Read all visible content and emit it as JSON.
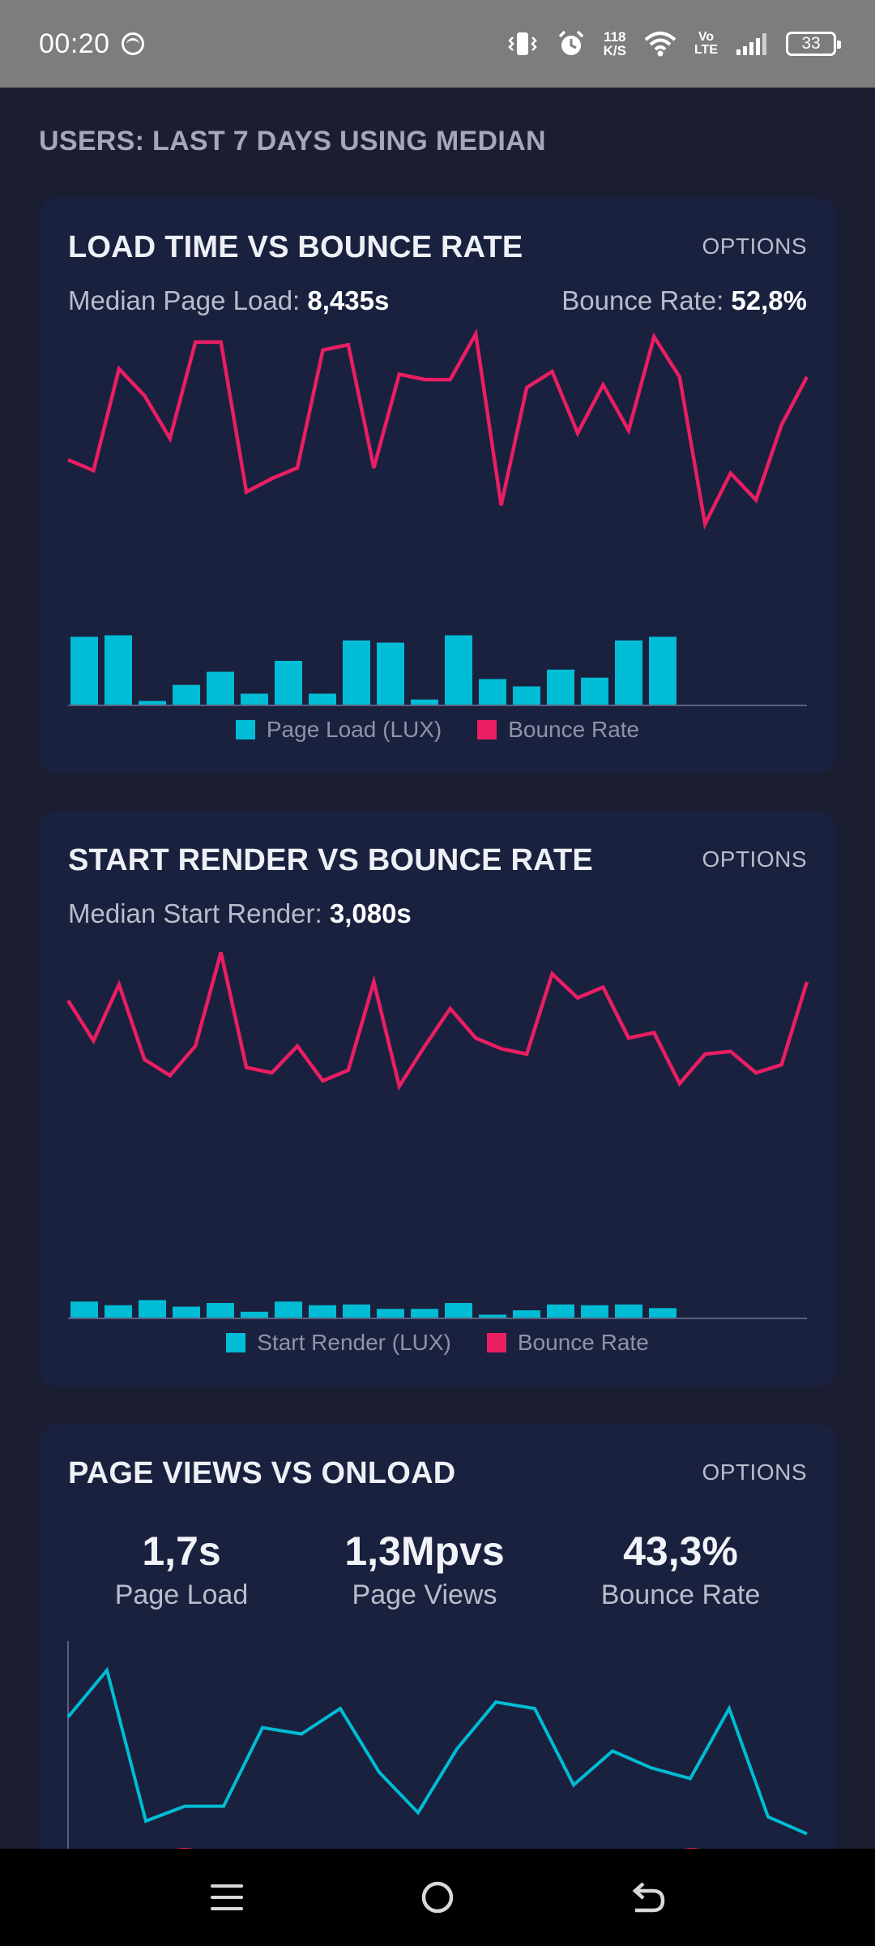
{
  "status": {
    "time": "00:20",
    "net_speed_value": "118",
    "net_speed_unit": "K/S",
    "volte_top": "Vo",
    "volte_bottom": "LTE",
    "battery": "33",
    "icons": [
      "face-icon",
      "vibrate-icon",
      "alarm-icon",
      "wifi-icon",
      "signal-icon",
      "battery-icon"
    ]
  },
  "page": {
    "heading": "USERS: LAST 7 DAYS USING MEDIAN"
  },
  "colors": {
    "bounce": "#e91e63",
    "bars": "#00bcd4",
    "card": "#19213e",
    "background": "#1b1d30"
  },
  "cards": [
    {
      "title": "LOAD TIME VS BOUNCE RATE",
      "options": "OPTIONS",
      "metric1_label": "Median Page Load: ",
      "metric1_value": "8,435s",
      "metric2_label": "Bounce Rate: ",
      "metric2_value": "52,8%",
      "legend": [
        "Page Load (LUX)",
        "Bounce Rate"
      ]
    },
    {
      "title": "START RENDER VS BOUNCE RATE",
      "options": "OPTIONS",
      "metric1_label": "Median Start Render: ",
      "metric1_value": "3,080s",
      "legend": [
        "Start Render (LUX)",
        "Bounce Rate"
      ]
    },
    {
      "title": "PAGE VIEWS VS ONLOAD",
      "options": "OPTIONS",
      "stats": [
        {
          "value": "1,7s",
          "label": "Page Load"
        },
        {
          "value": "1,3Mpvs",
          "label": "Page Views"
        },
        {
          "value": "43,3%",
          "label": "Bounce Rate"
        }
      ]
    }
  ],
  "chart_data": [
    {
      "type": "bar",
      "title": "LOAD TIME VS BOUNCE RATE",
      "series": [
        {
          "name": "Page Load (LUX)",
          "kind": "bar",
          "values": [
            0.93,
            0.95,
            0.05,
            0.27,
            0.45,
            0.15,
            0.6,
            0.15,
            0.88,
            0.85,
            0.07,
            0.95,
            0.35,
            0.25,
            0.48,
            0.37,
            0.88,
            0.93
          ]
        },
        {
          "name": "Bounce Rate",
          "kind": "line",
          "values": [
            0.53,
            0.49,
            0.87,
            0.77,
            0.61,
            0.97,
            0.97,
            0.41,
            0.46,
            0.5,
            0.94,
            0.96,
            0.5,
            0.85,
            0.83,
            0.83,
            1.0,
            0.36,
            0.8,
            0.86,
            0.63,
            0.81,
            0.64,
            0.99,
            0.84,
            0.29,
            0.48,
            0.38,
            0.66,
            0.84
          ]
        }
      ],
      "ylim": [
        0,
        1
      ]
    },
    {
      "type": "bar",
      "title": "START RENDER VS BOUNCE RATE",
      "series": [
        {
          "name": "Start Render (LUX)",
          "kind": "bar",
          "values": [
            0.22,
            0.17,
            0.24,
            0.15,
            0.2,
            0.08,
            0.22,
            0.17,
            0.18,
            0.12,
            0.12,
            0.2,
            0.04,
            0.1,
            0.18,
            0.17,
            0.18,
            0.13
          ]
        },
        {
          "name": "Bounce Rate",
          "kind": "line",
          "values": [
            0.8,
            0.65,
            0.86,
            0.58,
            0.52,
            0.63,
            0.98,
            0.55,
            0.53,
            0.63,
            0.5,
            0.54,
            0.87,
            0.48,
            0.63,
            0.77,
            0.66,
            0.62,
            0.6,
            0.9,
            0.81,
            0.85,
            0.66,
            0.68,
            0.49,
            0.6,
            0.61,
            0.53,
            0.56,
            0.87
          ]
        }
      ],
      "ylim": [
        0,
        1
      ]
    },
    {
      "type": "line",
      "title": "PAGE VIEWS VS ONLOAD",
      "series": [
        {
          "name": "Page Views",
          "kind": "line",
          "values": [
            0.62,
            0.84,
            0.13,
            0.2,
            0.2,
            0.57,
            0.54,
            0.66,
            0.36,
            0.17,
            0.47,
            0.69,
            0.66,
            0.3,
            0.46,
            0.38,
            0.33,
            0.66,
            0.15,
            0.07
          ]
        }
      ],
      "ylim": [
        0,
        1
      ]
    }
  ]
}
